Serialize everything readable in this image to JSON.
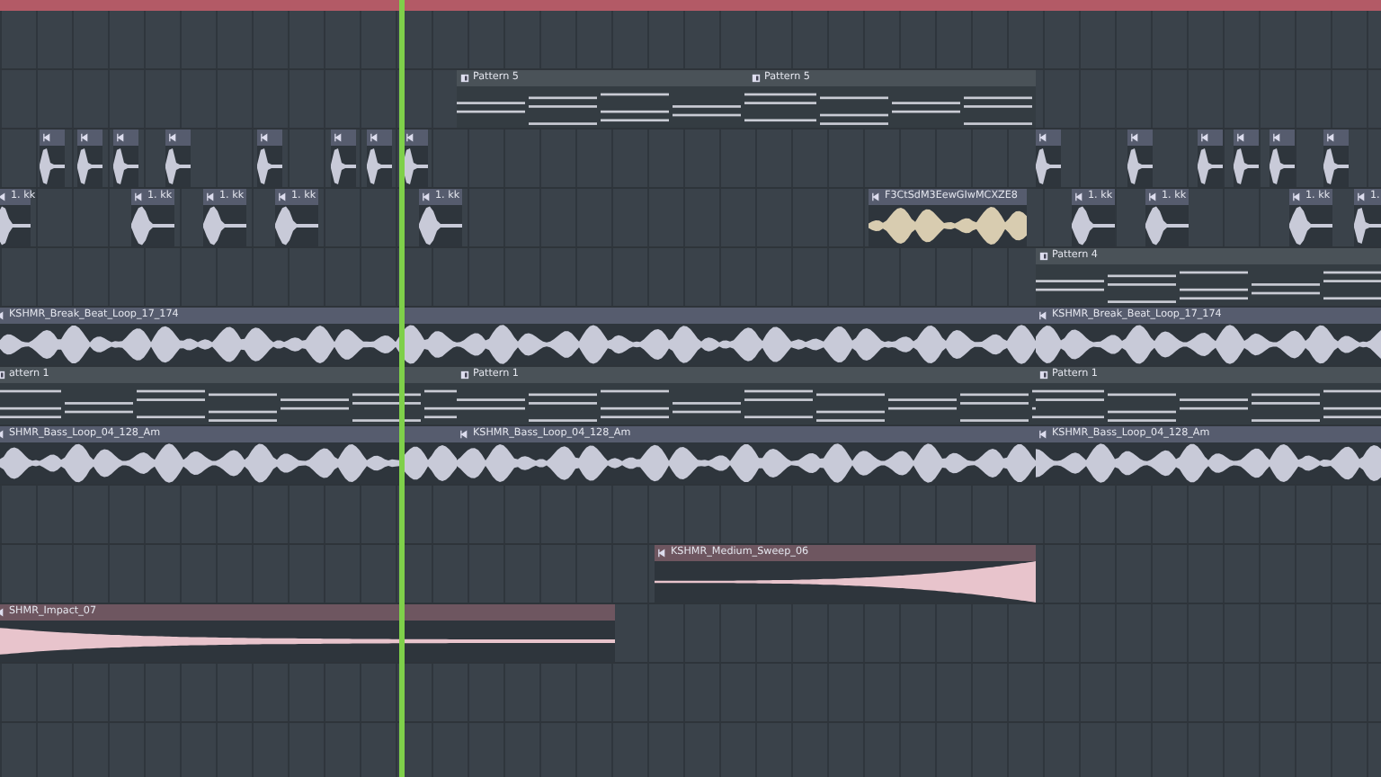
{
  "tracks": [
    {
      "clips": [
        {
          "kind": "pattern",
          "label": "Pattern 5"
        },
        {
          "kind": "pattern",
          "label": "Pattern 5"
        }
      ]
    },
    {
      "clips": [
        {
          "kind": "hit"
        },
        {
          "kind": "hit"
        },
        {
          "kind": "hit"
        },
        {
          "kind": "hit"
        },
        {
          "kind": "hit"
        },
        {
          "kind": "hit"
        },
        {
          "kind": "hit"
        },
        {
          "kind": "hit"
        },
        {
          "kind": "hit"
        },
        {
          "kind": "hit"
        },
        {
          "kind": "hit"
        },
        {
          "kind": "hit"
        },
        {
          "kind": "hit"
        },
        {
          "kind": "hit"
        }
      ]
    },
    {
      "clips": [
        {
          "kind": "hit",
          "label": "1. kk"
        },
        {
          "kind": "hit",
          "label": "1. kk"
        },
        {
          "kind": "hit",
          "label": "1. kk"
        },
        {
          "kind": "hit",
          "label": "1. kk"
        },
        {
          "kind": "hit",
          "label": "1. kk"
        },
        {
          "kind": "audio",
          "label": "F3CtSdM3EewGIwMCXZE8",
          "color": "#d8ccb0"
        },
        {
          "kind": "hit",
          "label": "1. kk"
        },
        {
          "kind": "hit",
          "label": "1. kk"
        },
        {
          "kind": "hit",
          "label": "1. kk"
        },
        {
          "kind": "hit",
          "label": "1."
        }
      ]
    },
    {
      "clips": [
        {
          "kind": "pattern",
          "label": "Pattern 4"
        }
      ]
    },
    {
      "clips": [
        {
          "kind": "audio",
          "label": "KSHMR_Break_Beat_Loop_17_174",
          "color": "#c8cad8"
        },
        {
          "kind": "audio",
          "label": "KSHMR_Break_Beat_Loop_17_174",
          "color": "#c8cad8"
        }
      ]
    },
    {
      "clips": [
        {
          "kind": "pattern",
          "label": "attern 1"
        },
        {
          "kind": "pattern",
          "label": "Pattern 1"
        },
        {
          "kind": "pattern",
          "label": "Pattern 1"
        }
      ]
    },
    {
      "clips": [
        {
          "kind": "audio",
          "label": "SHMR_Bass_Loop_04_128_Am",
          "color": "#c8cad8"
        },
        {
          "kind": "audio",
          "label": "KSHMR_Bass_Loop_04_128_Am",
          "color": "#c8cad8"
        },
        {
          "kind": "audio",
          "label": "KSHMR_Bass_Loop_04_128_Am",
          "color": "#c8cad8"
        }
      ]
    },
    {
      "clips": [
        {
          "kind": "sweep",
          "label": "KSHMR_Medium_Sweep_06",
          "color": "#e8c4cc"
        }
      ]
    },
    {
      "clips": [
        {
          "kind": "impact",
          "label": "SHMR_Impact_07",
          "color": "#e8c4cc"
        }
      ]
    }
  ]
}
